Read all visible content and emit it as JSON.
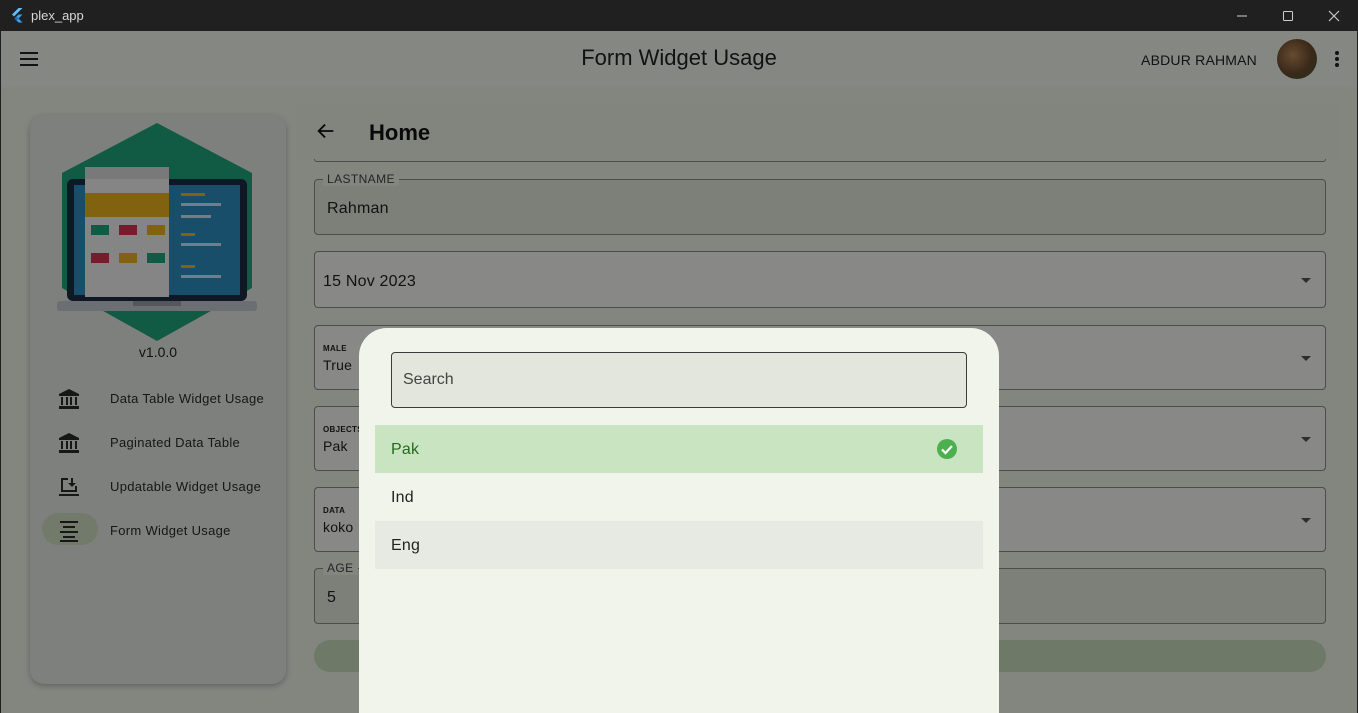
{
  "window": {
    "title": "plex_app"
  },
  "appbar": {
    "title": "Form Widget Usage",
    "user_name": "ABDUR RAHMAN"
  },
  "sidebar": {
    "version": "v1.0.0",
    "items": [
      {
        "label": "Data Table Widget Usage",
        "icon": "bank-icon"
      },
      {
        "label": "Paginated Data Table",
        "icon": "bank-icon"
      },
      {
        "label": "Updatable Widget Usage",
        "icon": "download-monitor-icon"
      },
      {
        "label": "Form Widget Usage",
        "icon": "align-center-icon",
        "active": true
      }
    ]
  },
  "content": {
    "title": "Home",
    "fields": {
      "lastname_label": "LASTNAME",
      "lastname_value": "Rahman",
      "date_value": "15 Nov 2023",
      "male_label": "MALE",
      "male_value": "True",
      "objects_label": "OBJECTS",
      "objects_value": "Pak",
      "data_label": "DATA",
      "data_value": "koko",
      "age_label": "AGE",
      "age_value": "5"
    }
  },
  "dialog": {
    "search_placeholder": "Search",
    "options": [
      {
        "label": "Pak",
        "selected": true
      },
      {
        "label": "Ind",
        "selected": false
      },
      {
        "label": "Eng",
        "selected": false
      }
    ]
  },
  "colors": {
    "accent": "#4caf50",
    "selected_bg": "#c9e4c1",
    "selected_text": "#236b1f",
    "dialog_bg": "#f1f4eb"
  }
}
